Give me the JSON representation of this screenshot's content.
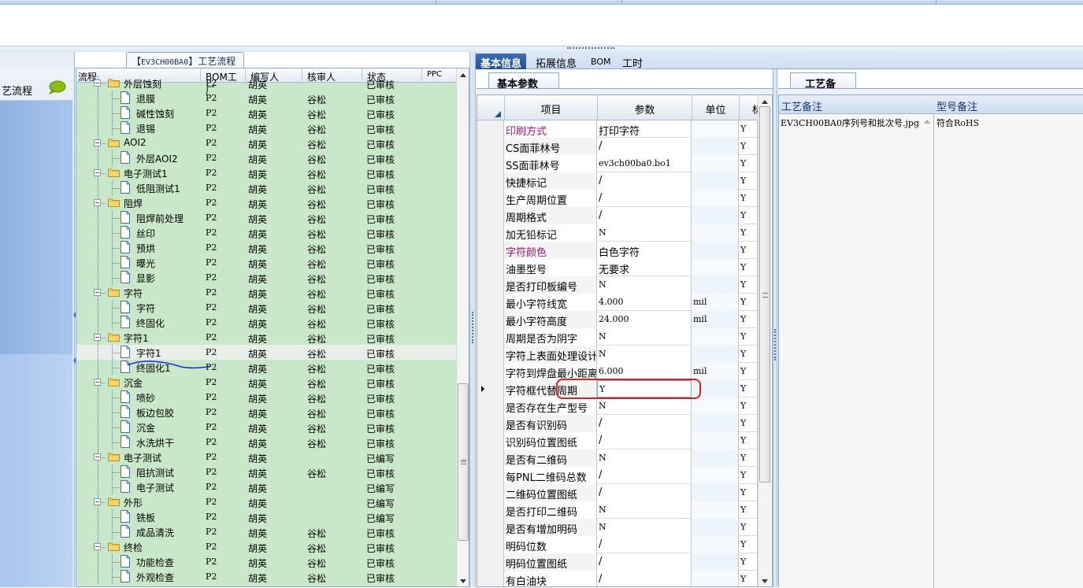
{
  "tree": {
    "tab_title_code": "EV3CH00BA0",
    "tab_title_text": "工艺流程",
    "columns": [
      "流程",
      "BOM工厂",
      "编写人",
      "核审人",
      "状态",
      "PPC"
    ],
    "rows": [
      {
        "level": 1,
        "type": "folder",
        "name": "外层蚀刻",
        "bom": "P2",
        "writer": "胡英",
        "reviewer": "",
        "status": "已审核",
        "partial": true
      },
      {
        "level": 2,
        "type": "file",
        "name": "退膜",
        "bom": "P2",
        "writer": "胡英",
        "reviewer": "谷松",
        "status": "已审核"
      },
      {
        "level": 2,
        "type": "file",
        "name": "碱性蚀刻",
        "bom": "P2",
        "writer": "胡英",
        "reviewer": "谷松",
        "status": "已审核"
      },
      {
        "level": 2,
        "type": "file",
        "name": "退锡",
        "bom": "P2",
        "writer": "胡英",
        "reviewer": "谷松",
        "status": "已审核"
      },
      {
        "level": 1,
        "type": "folder",
        "name": "AOI2",
        "bom": "P2",
        "writer": "胡英",
        "reviewer": "谷松",
        "status": "已审核"
      },
      {
        "level": 2,
        "type": "file",
        "name": "外层AOI2",
        "bom": "P2",
        "writer": "胡英",
        "reviewer": "谷松",
        "status": "已审核"
      },
      {
        "level": 1,
        "type": "folder",
        "name": "电子测试1",
        "bom": "P2",
        "writer": "胡英",
        "reviewer": "谷松",
        "status": "已审核"
      },
      {
        "level": 2,
        "type": "file",
        "name": "低阻测试1",
        "bom": "P2",
        "writer": "胡英",
        "reviewer": "谷松",
        "status": "已审核"
      },
      {
        "level": 1,
        "type": "folder",
        "name": "阻焊",
        "bom": "P2",
        "writer": "胡英",
        "reviewer": "谷松",
        "status": "已审核"
      },
      {
        "level": 2,
        "type": "file",
        "name": "阻焊前处理",
        "bom": "P2",
        "writer": "胡英",
        "reviewer": "谷松",
        "status": "已审核"
      },
      {
        "level": 2,
        "type": "file",
        "name": "丝印",
        "bom": "P2",
        "writer": "胡英",
        "reviewer": "谷松",
        "status": "已审核"
      },
      {
        "level": 2,
        "type": "file",
        "name": "预烘",
        "bom": "P2",
        "writer": "胡英",
        "reviewer": "谷松",
        "status": "已审核"
      },
      {
        "level": 2,
        "type": "file",
        "name": "曝光",
        "bom": "P2",
        "writer": "胡英",
        "reviewer": "谷松",
        "status": "已审核"
      },
      {
        "level": 2,
        "type": "file",
        "name": "显影",
        "bom": "P2",
        "writer": "胡英",
        "reviewer": "谷松",
        "status": "已审核"
      },
      {
        "level": 1,
        "type": "folder",
        "name": "字符",
        "bom": "P2",
        "writer": "胡英",
        "reviewer": "谷松",
        "status": "已审核"
      },
      {
        "level": 2,
        "type": "file",
        "name": "字符",
        "bom": "P2",
        "writer": "胡英",
        "reviewer": "谷松",
        "status": "已审核"
      },
      {
        "level": 2,
        "type": "file",
        "name": "终固化",
        "bom": "P2",
        "writer": "胡英",
        "reviewer": "谷松",
        "status": "已审核"
      },
      {
        "level": 1,
        "type": "folder",
        "name": "字符1",
        "bom": "P2",
        "writer": "胡英",
        "reviewer": "谷松",
        "status": "已审核"
      },
      {
        "level": 2,
        "type": "file",
        "name": "字符1",
        "bom": "P2",
        "writer": "胡英",
        "reviewer": "谷松",
        "status": "已审核",
        "selected": true
      },
      {
        "level": 2,
        "type": "file",
        "name": "终固化1",
        "bom": "P2",
        "writer": "胡英",
        "reviewer": "谷松",
        "status": "已审核"
      },
      {
        "level": 1,
        "type": "folder",
        "name": "沉金",
        "bom": "P2",
        "writer": "胡英",
        "reviewer": "谷松",
        "status": "已审核"
      },
      {
        "level": 2,
        "type": "file",
        "name": "喷砂",
        "bom": "P2",
        "writer": "胡英",
        "reviewer": "谷松",
        "status": "已审核"
      },
      {
        "level": 2,
        "type": "file",
        "name": "板边包胶",
        "bom": "P2",
        "writer": "胡英",
        "reviewer": "谷松",
        "status": "已审核"
      },
      {
        "level": 2,
        "type": "file",
        "name": "沉金",
        "bom": "P2",
        "writer": "胡英",
        "reviewer": "谷松",
        "status": "已审核"
      },
      {
        "level": 2,
        "type": "file",
        "name": "水洗烘干",
        "bom": "P2",
        "writer": "胡英",
        "reviewer": "谷松",
        "status": "已审核"
      },
      {
        "level": 1,
        "type": "folder",
        "name": "电子测试",
        "bom": "P2",
        "writer": "胡英",
        "reviewer": "",
        "status": "已编写"
      },
      {
        "level": 2,
        "type": "file",
        "name": "阻抗测试",
        "bom": "P2",
        "writer": "胡英",
        "reviewer": "谷松",
        "status": "已审核"
      },
      {
        "level": 2,
        "type": "file",
        "name": "电子测试",
        "bom": "P2",
        "writer": "胡英",
        "reviewer": "",
        "status": "已编写"
      },
      {
        "level": 1,
        "type": "folder",
        "name": "外形",
        "bom": "P2",
        "writer": "胡英",
        "reviewer": "",
        "status": "已编写"
      },
      {
        "level": 2,
        "type": "file",
        "name": "铣板",
        "bom": "P2",
        "writer": "胡英",
        "reviewer": "",
        "status": "已编写"
      },
      {
        "level": 2,
        "type": "file",
        "name": "成品清洗",
        "bom": "P2",
        "writer": "胡英",
        "reviewer": "谷松",
        "status": "已审核"
      },
      {
        "level": 1,
        "type": "folder",
        "name": "终检",
        "bom": "P2",
        "writer": "胡英",
        "reviewer": "谷松",
        "status": "已审核"
      },
      {
        "level": 2,
        "type": "file",
        "name": "功能检查",
        "bom": "P2",
        "writer": "胡英",
        "reviewer": "谷松",
        "status": "已审核"
      },
      {
        "level": 2,
        "type": "file",
        "name": "外观检查",
        "bom": "P2",
        "writer": "胡英",
        "reviewer": "谷松",
        "status": "已审核"
      }
    ]
  },
  "left_menu": {
    "label": "艺流程"
  },
  "right_tabs": [
    "基本信息",
    "拓展信息",
    "BOM",
    "工时"
  ],
  "params": {
    "tab": "基本参数",
    "columns": [
      "项目",
      "参数",
      "单位",
      "标"
    ],
    "rows": [
      {
        "item": "印刷方式",
        "value": "打印字符",
        "unit": "",
        "flag": "Y",
        "pink": true
      },
      {
        "item": "CS面菲林号",
        "value": "/",
        "unit": "",
        "flag": "Y"
      },
      {
        "item": "SS面菲林号",
        "value": "ev3ch00ba0.bo1",
        "unit": "",
        "flag": "Y",
        "mono": true
      },
      {
        "item": "快捷标记",
        "value": "/",
        "unit": "",
        "flag": "Y"
      },
      {
        "item": "生产周期位置",
        "value": "/",
        "unit": "",
        "flag": "Y"
      },
      {
        "item": "周期格式",
        "value": "/",
        "unit": "",
        "flag": "Y"
      },
      {
        "item": "加无铅标记",
        "value": "N",
        "unit": "",
        "flag": "Y",
        "mono": true
      },
      {
        "item": "字符颜色",
        "value": "白色字符",
        "unit": "",
        "flag": "Y",
        "pink": true
      },
      {
        "item": "油墨型号",
        "value": "无要求",
        "unit": "",
        "flag": "Y"
      },
      {
        "item": "是否打印板编号",
        "value": "N",
        "unit": "",
        "flag": "Y",
        "mono": true
      },
      {
        "item": "最小字符线宽",
        "value": "4.000",
        "unit": "mil",
        "flag": "Y",
        "mono": true
      },
      {
        "item": "最小字符高度",
        "value": "24.000",
        "unit": "mil",
        "flag": "Y",
        "mono": true
      },
      {
        "item": "周期是否为阴字",
        "value": "N",
        "unit": "",
        "flag": "Y",
        "mono": true
      },
      {
        "item": "字符上表面处理设计",
        "value": "N",
        "unit": "",
        "flag": "Y",
        "mono": true
      },
      {
        "item": "字符到焊盘最小距离",
        "value": "6.000",
        "unit": "mil",
        "flag": "Y",
        "mono": true
      },
      {
        "item": "字符框代替周期",
        "value": "Y",
        "unit": "",
        "flag": "Y",
        "mono": true,
        "editing": true
      },
      {
        "item": "是否存在生产型号",
        "value": "N",
        "unit": "",
        "flag": "Y",
        "mono": true
      },
      {
        "item": "是否有识别码",
        "value": "/",
        "unit": "",
        "flag": "Y"
      },
      {
        "item": "识别码位置图纸",
        "value": "/",
        "unit": "",
        "flag": "Y"
      },
      {
        "item": "是否有二维码",
        "value": "N",
        "unit": "",
        "flag": "Y",
        "mono": true
      },
      {
        "item": "每PNL二维码总数",
        "value": "/",
        "unit": "",
        "flag": "Y"
      },
      {
        "item": "二维码位置图纸",
        "value": "/",
        "unit": "",
        "flag": "Y"
      },
      {
        "item": "是否打印二维码",
        "value": "N",
        "unit": "",
        "flag": "Y",
        "mono": true
      },
      {
        "item": "是否有增加明码",
        "value": "N",
        "unit": "",
        "flag": "Y",
        "mono": true
      },
      {
        "item": "明码位数",
        "value": "/",
        "unit": "",
        "flag": "Y"
      },
      {
        "item": "明码位置图纸",
        "value": "/",
        "unit": "",
        "flag": "Y"
      },
      {
        "item": "有白油块",
        "value": "/",
        "unit": "",
        "flag": "Y"
      }
    ]
  },
  "notes": {
    "tab": "工艺备注",
    "col1_header": "工艺备注",
    "col2_header": "型号备注",
    "col1_value": "EV3CH00BA0序列号和批次号.jpg",
    "col2_value": "符合RoHS"
  },
  "colors": {
    "tree_bg": "#c9e8c9",
    "accent": "#1f4f96",
    "highlight": "#d9231f",
    "pink_text": "#b01076"
  }
}
